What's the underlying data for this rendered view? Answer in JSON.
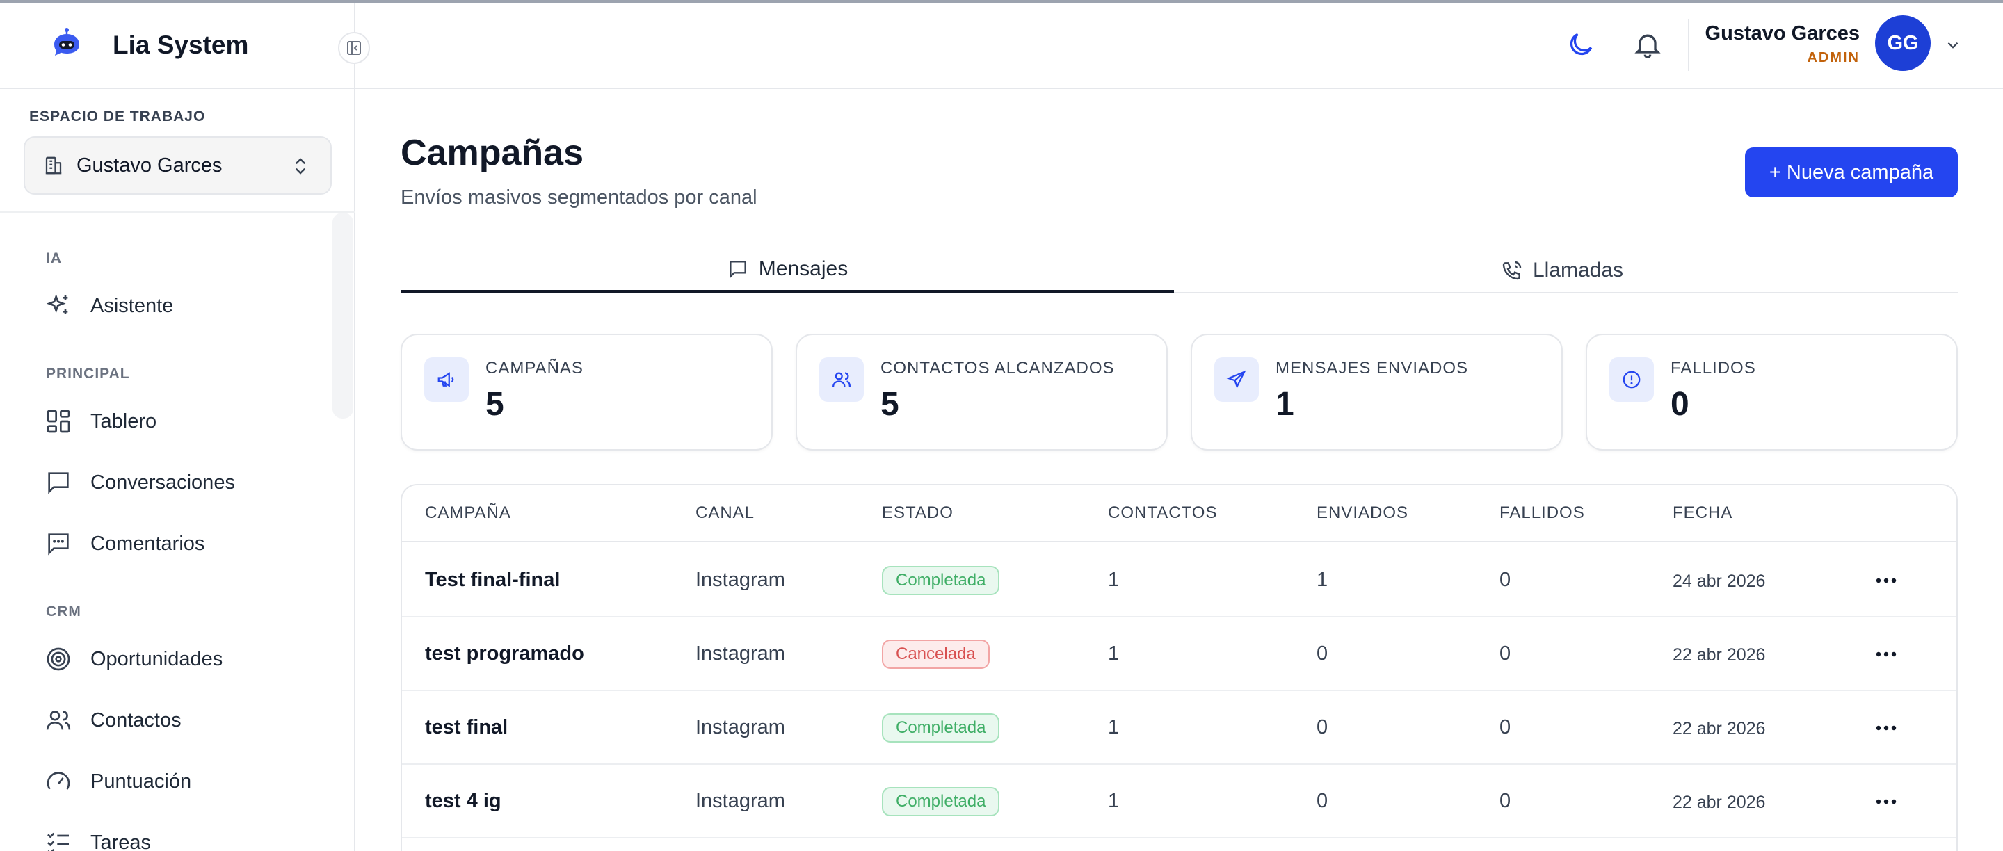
{
  "app": {
    "name": "Lia System"
  },
  "workspace": {
    "label": "ESPACIO DE TRABAJO",
    "name": "Gustavo Garces"
  },
  "sidebar": {
    "sections": [
      {
        "label": "IA",
        "items": [
          {
            "label": "Asistente",
            "icon": "sparkles-icon"
          }
        ]
      },
      {
        "label": "PRINCIPAL",
        "items": [
          {
            "label": "Tablero",
            "icon": "dashboard-icon"
          },
          {
            "label": "Conversaciones",
            "icon": "message-square-icon"
          },
          {
            "label": "Comentarios",
            "icon": "message-dots-icon"
          }
        ]
      },
      {
        "label": "CRM",
        "items": [
          {
            "label": "Oportunidades",
            "icon": "target-icon"
          },
          {
            "label": "Contactos",
            "icon": "users-icon"
          },
          {
            "label": "Puntuación",
            "icon": "gauge-icon"
          },
          {
            "label": "Tareas",
            "icon": "list-checks-icon"
          }
        ]
      }
    ]
  },
  "header": {
    "user": {
      "name": "Gustavo Garces",
      "role": "ADMIN",
      "initials": "GG"
    }
  },
  "page": {
    "title": "Campañas",
    "subtitle": "Envíos masivos segmentados por canal",
    "new_button": "+ Nueva campaña",
    "tabs": [
      {
        "label": "Mensajes",
        "active": true
      },
      {
        "label": "Llamadas",
        "active": false
      }
    ]
  },
  "stats": [
    {
      "label": "CAMPAÑAS",
      "value": "5",
      "icon": "megaphone-icon"
    },
    {
      "label": "CONTACTOS ALCANZADOS",
      "value": "5",
      "icon": "users-icon"
    },
    {
      "label": "MENSAJES ENVIADOS",
      "value": "1",
      "icon": "send-icon"
    },
    {
      "label": "FALLIDOS",
      "value": "0",
      "icon": "alert-circle-icon"
    }
  ],
  "table": {
    "columns": [
      "CAMPAÑA",
      "CANAL",
      "ESTADO",
      "CONTACTOS",
      "ENVIADOS",
      "FALLIDOS",
      "FECHA"
    ],
    "rows": [
      {
        "name": "Test final-final",
        "channel": "Instagram",
        "status": "Completada",
        "contacts": "1",
        "sent": "1",
        "failed": "0",
        "date": "24 abr 2026"
      },
      {
        "name": "test programado",
        "channel": "Instagram",
        "status": "Cancelada",
        "contacts": "1",
        "sent": "0",
        "failed": "0",
        "date": "22 abr 2026"
      },
      {
        "name": "test final",
        "channel": "Instagram",
        "status": "Completada",
        "contacts": "1",
        "sent": "0",
        "failed": "0",
        "date": "22 abr 2026"
      },
      {
        "name": "test 4 ig",
        "channel": "Instagram",
        "status": "Completada",
        "contacts": "1",
        "sent": "0",
        "failed": "0",
        "date": "22 abr 2026"
      }
    ]
  },
  "colors": {
    "accent": "#2445f0",
    "avatar": "#1d3fd6",
    "role": "#c2620b",
    "success": "#3fae66",
    "danger": "#d85151"
  }
}
